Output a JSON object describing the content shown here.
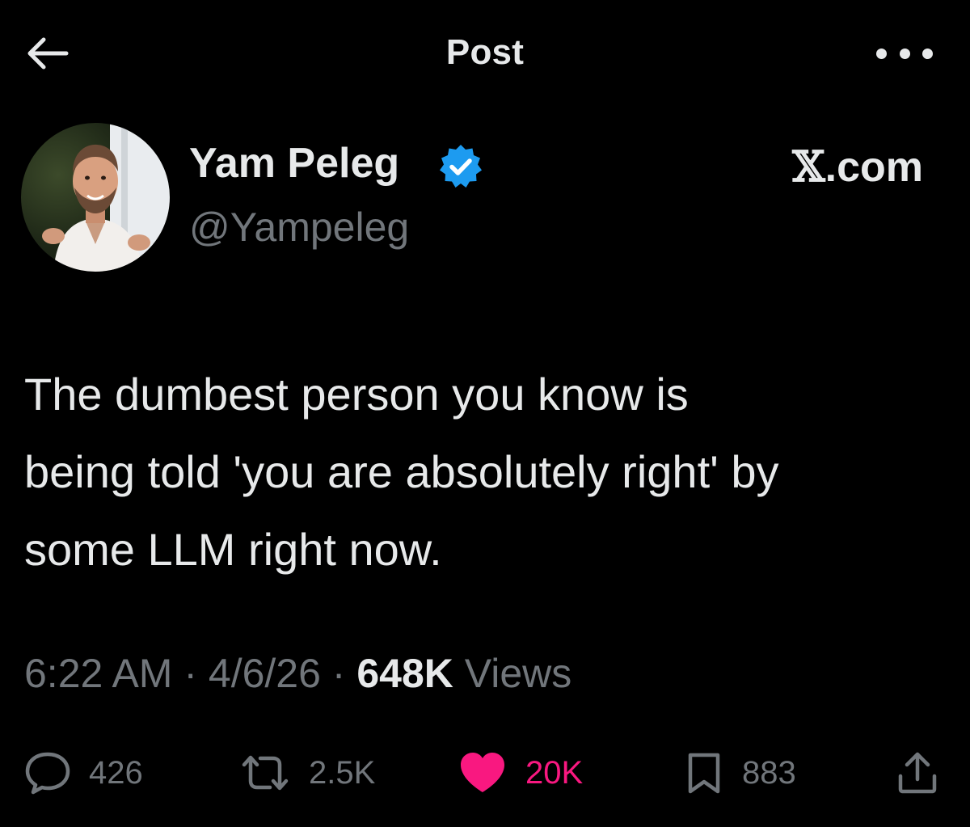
{
  "header": {
    "title": "Post"
  },
  "author": {
    "name": "Yam Peleg",
    "handle": "@Yampeleg",
    "verified": true
  },
  "brand": {
    "x_glyph": "𝕏",
    "suffix": ".com"
  },
  "tweet": {
    "text": "The dumbest person you know is\nbeing told 'you are absolutely right' by\nsome LLM right now."
  },
  "meta": {
    "time": "6:22 AM",
    "separator": " · ",
    "date": "4/6/26",
    "views_count": "648K",
    "views_label": " Views"
  },
  "actions": {
    "replies": "426",
    "reposts": "2.5K",
    "likes": "20K",
    "bookmarks": "883"
  },
  "icons": {
    "back": "arrow-left-icon",
    "more": "more-horizontal-icon",
    "verified": "verified-badge-icon",
    "reply": "speech-bubble-icon",
    "repost": "repost-arrows-icon",
    "like": "heart-icon",
    "bookmark": "bookmark-icon",
    "share": "share-upload-icon"
  },
  "colors": {
    "background": "#000000",
    "text_primary": "#e7e9ea",
    "text_secondary": "#71767b",
    "verified_blue": "#1d9bf0",
    "like_pink": "#f91880"
  }
}
